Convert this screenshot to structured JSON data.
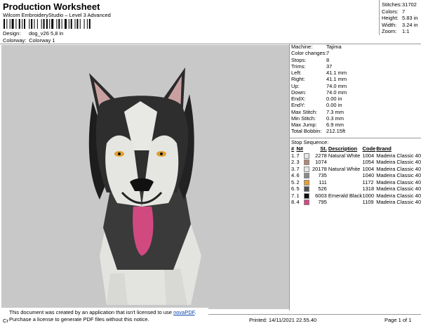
{
  "header": {
    "title": "Production Worksheet",
    "subtitle": "Wilcom EmbroideryStudio – Level 3 Advanced",
    "design_label": "Design:",
    "design_value": "dog_v26 5,8 in",
    "colorway_label": "Colorway:",
    "colorway_value": "Colorway 1"
  },
  "stats": {
    "stitches_label": "Stitches:",
    "stitches": "31702",
    "colors_label": "Colors:",
    "colors": "7",
    "height_label": "Height:",
    "height": "5.83 in",
    "width_label": "Width:",
    "width": "3.24 in",
    "zoom_label": "Zoom:",
    "zoom": "1:1"
  },
  "machine_info": [
    {
      "label": "Machine:",
      "value": "Tajima"
    },
    {
      "label": "Color changes:",
      "value": "7"
    },
    {
      "label": "Stops:",
      "value": "8"
    },
    {
      "label": "Trims:",
      "value": "37"
    },
    {
      "label": "Left:",
      "value": "41.1 mm"
    },
    {
      "label": "Right:",
      "value": "41.1 mm"
    },
    {
      "label": "Up:",
      "value": "74.0 mm"
    },
    {
      "label": "Down:",
      "value": "74.0 mm"
    },
    {
      "label": "EndX:",
      "value": "0.00 in"
    },
    {
      "label": "EndY:",
      "value": "0.00 in"
    },
    {
      "label": "Max Stitch:",
      "value": "7.3 mm"
    },
    {
      "label": "Min Stitch:",
      "value": "0.3 mm"
    },
    {
      "label": "Max Jump:",
      "value": "6.9 mm"
    },
    {
      "label": "Total Bobbin:",
      "value": "212.15ft"
    }
  ],
  "stop_sequence": {
    "title": "Stop Sequence:",
    "columns": [
      "#",
      "N#",
      "St.",
      "Description",
      "Code",
      "Brand"
    ],
    "rows": [
      {
        "num": "1.",
        "n": "7",
        "color": "#e6e6e6",
        "st": "2278",
        "desc": "Natural White",
        "code": "1004",
        "brand": "Madeira Classic 40"
      },
      {
        "num": "2.",
        "n": "3",
        "color": "#b08878",
        "st": "1074",
        "desc": "",
        "code": "1054",
        "brand": "Madeira Classic 40"
      },
      {
        "num": "3.",
        "n": "7",
        "color": "#e6e6e6",
        "st": "20178",
        "desc": "Natural White",
        "code": "1004",
        "brand": "Madeira Classic 40"
      },
      {
        "num": "4.",
        "n": "6",
        "color": "#8a8a8a",
        "st": "735",
        "desc": "",
        "code": "1040",
        "brand": "Madeira Classic 40"
      },
      {
        "num": "5.",
        "n": "2",
        "color": "#e8a030",
        "st": "111",
        "desc": "",
        "code": "1172",
        "brand": "Madeira Classic 40"
      },
      {
        "num": "6.",
        "n": "5",
        "color": "#505050",
        "st": "526",
        "desc": "",
        "code": "1318",
        "brand": "Madeira Classic 40"
      },
      {
        "num": "7.",
        "n": "1",
        "color": "#101010",
        "st": "6003",
        "desc": "Emerald Black",
        "code": "1000",
        "brand": "Madeira Classic 40"
      },
      {
        "num": "8.",
        "n": "4",
        "color": "#d04a80",
        "st": "795",
        "desc": "",
        "code": "1109",
        "brand": "Madeira Classic 40"
      }
    ]
  },
  "notice": {
    "line1_prefix": "This document was created by an application that isn't licensed to use ",
    "link": "novaPDF",
    "line1_suffix": ".",
    "line2": "Purchase a license to generate PDF files without this notice.",
    "cr": "Cr"
  },
  "footer": {
    "printed": "Printed: 14/11/2021 22.55.40",
    "page": "Page 1 of 1"
  },
  "colors": {
    "background_panel": "#c8c8c8",
    "tongue": "#d04a80",
    "link": "#0645ad"
  }
}
